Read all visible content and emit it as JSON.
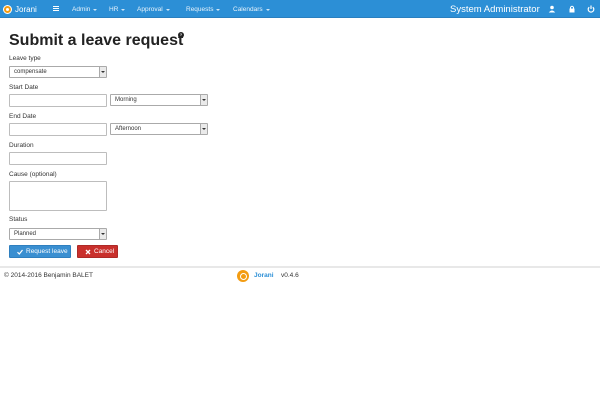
{
  "navbar": {
    "brand": "Jorani",
    "items": [
      {
        "label": "Admin"
      },
      {
        "label": "HR"
      },
      {
        "label": "Approval"
      },
      {
        "label": "Requests"
      },
      {
        "label": "Calendars"
      }
    ],
    "user": "System Administrator",
    "icons": [
      "home-icon",
      "user-icon",
      "lock-icon",
      "power-icon"
    ],
    "color": "#2c8fd6"
  },
  "page": {
    "title": "Submit a leave request"
  },
  "form": {
    "leave_type": {
      "label": "Leave type",
      "value": "compensate"
    },
    "start_date": {
      "label": "Start Date",
      "value": "",
      "period": "Morning"
    },
    "end_date": {
      "label": "End Date",
      "value": "",
      "period": "Afternoon"
    },
    "duration": {
      "label": "Duration",
      "value": ""
    },
    "cause": {
      "label": "Cause (optional)",
      "value": ""
    },
    "status": {
      "label": "Status",
      "value": "Planned"
    },
    "submit_label": "Request leave",
    "cancel_label": "Cancel"
  },
  "footer": {
    "copyright": "© 2014-2016 Benjamin BALET",
    "brand": "Jorani",
    "version": "v0.4.6"
  }
}
